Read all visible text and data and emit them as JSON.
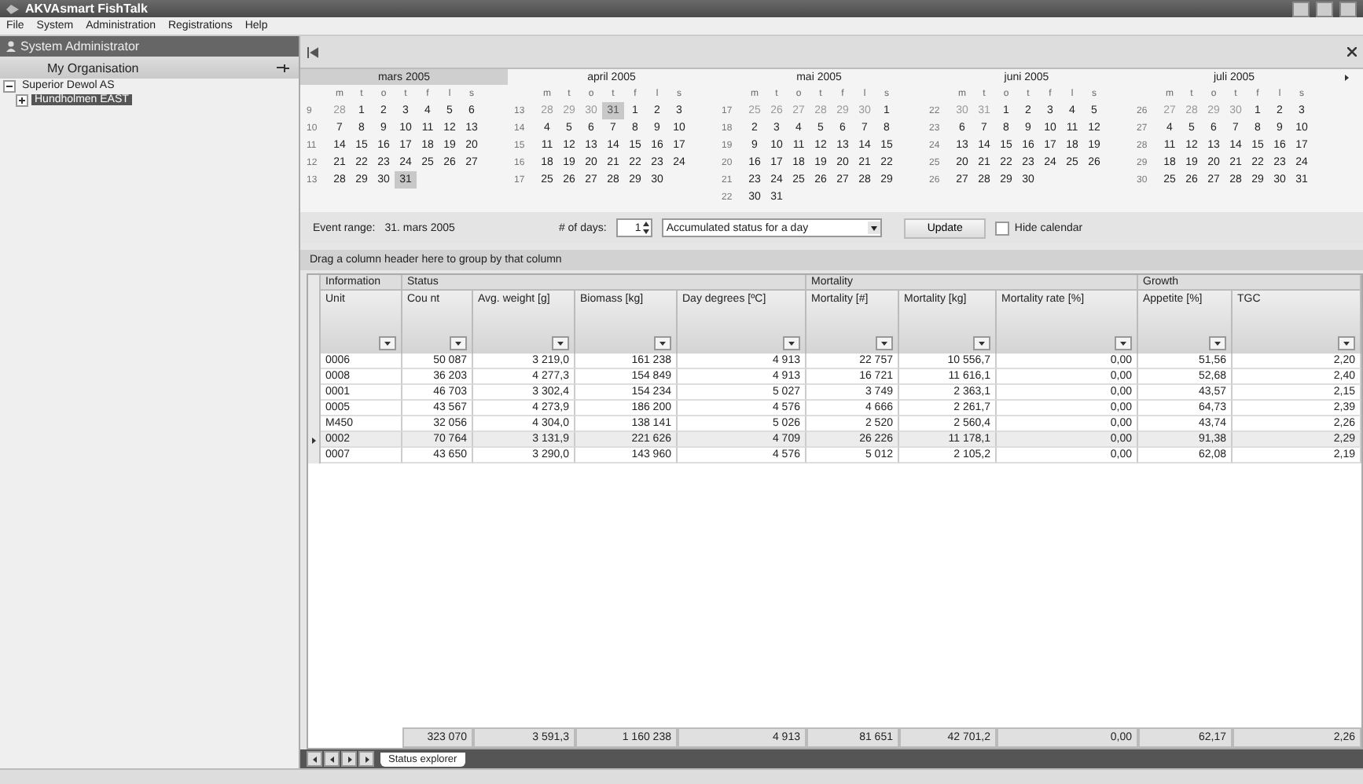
{
  "window": {
    "title": "AKVAsmart FishTalk"
  },
  "menu": [
    "File",
    "System",
    "Administration",
    "Registrations",
    "Help"
  ],
  "sidebar": {
    "header": "System Administrator",
    "section": "My Organisation",
    "tree": [
      {
        "label": "Superior Dewol AS",
        "expanded": true,
        "selected": false,
        "children": [
          {
            "label": "Hundholmen EAST",
            "expanded": false,
            "selected": true
          }
        ]
      }
    ]
  },
  "calendar": {
    "months": [
      {
        "title": "mars 2005",
        "selected": true,
        "weekdays": [
          "m",
          "t",
          "o",
          "t",
          "f",
          "l",
          "s"
        ],
        "weeks": [
          {
            "number": "9",
            "days": [
              {
                "day": "28",
                "outside": true,
                "selected": false
              },
              {
                "day": "1",
                "outside": false,
                "selected": false
              },
              {
                "day": "2",
                "outside": false,
                "selected": false
              },
              {
                "day": "3",
                "outside": false,
                "selected": false
              },
              {
                "day": "4",
                "outside": false,
                "selected": false
              },
              {
                "day": "5",
                "outside": false,
                "selected": false
              },
              {
                "day": "6",
                "outside": false,
                "selected": false
              }
            ]
          },
          {
            "number": "10",
            "days": [
              {
                "day": "7",
                "outside": false,
                "selected": false
              },
              {
                "day": "8",
                "outside": false,
                "selected": false
              },
              {
                "day": "9",
                "outside": false,
                "selected": false
              },
              {
                "day": "10",
                "outside": false,
                "selected": false
              },
              {
                "day": "11",
                "outside": false,
                "selected": false
              },
              {
                "day": "12",
                "outside": false,
                "selected": false
              },
              {
                "day": "13",
                "outside": false,
                "selected": false
              }
            ]
          },
          {
            "number": "11",
            "days": [
              {
                "day": "14",
                "outside": false,
                "selected": false
              },
              {
                "day": "15",
                "outside": false,
                "selected": false
              },
              {
                "day": "16",
                "outside": false,
                "selected": false
              },
              {
                "day": "17",
                "outside": false,
                "selected": false
              },
              {
                "day": "18",
                "outside": false,
                "selected": false
              },
              {
                "day": "19",
                "outside": false,
                "selected": false
              },
              {
                "day": "20",
                "outside": false,
                "selected": false
              }
            ]
          },
          {
            "number": "12",
            "days": [
              {
                "day": "21",
                "outside": false,
                "selected": false
              },
              {
                "day": "22",
                "outside": false,
                "selected": false
              },
              {
                "day": "23",
                "outside": false,
                "selected": false
              },
              {
                "day": "24",
                "outside": false,
                "selected": false
              },
              {
                "day": "25",
                "outside": false,
                "selected": false
              },
              {
                "day": "26",
                "outside": false,
                "selected": false
              },
              {
                "day": "27",
                "outside": false,
                "selected": false
              }
            ]
          },
          {
            "number": "13",
            "days": [
              {
                "day": "28",
                "outside": false,
                "selected": false
              },
              {
                "day": "29",
                "outside": false,
                "selected": false
              },
              {
                "day": "30",
                "outside": false,
                "selected": false
              },
              {
                "day": "31",
                "outside": false,
                "selected": true
              }
            ]
          }
        ]
      },
      {
        "title": "april 2005",
        "selected": false,
        "weekdays": [
          "m",
          "t",
          "o",
          "t",
          "f",
          "l",
          "s"
        ],
        "weeks": [
          {
            "number": "13",
            "days": [
              {
                "day": "28",
                "outside": true,
                "selected": false
              },
              {
                "day": "29",
                "outside": true,
                "selected": false
              },
              {
                "day": "30",
                "outside": true,
                "selected": false
              },
              {
                "day": "31",
                "outside": true,
                "selected": true
              },
              {
                "day": "1",
                "outside": false,
                "selected": false
              },
              {
                "day": "2",
                "outside": false,
                "selected": false
              },
              {
                "day": "3",
                "outside": false,
                "selected": false
              }
            ]
          },
          {
            "number": "14",
            "days": [
              {
                "day": "4",
                "outside": false,
                "selected": false
              },
              {
                "day": "5",
                "outside": false,
                "selected": false
              },
              {
                "day": "6",
                "outside": false,
                "selected": false
              },
              {
                "day": "7",
                "outside": false,
                "selected": false
              },
              {
                "day": "8",
                "outside": false,
                "selected": false
              },
              {
                "day": "9",
                "outside": false,
                "selected": false
              },
              {
                "day": "10",
                "outside": false,
                "selected": false
              }
            ]
          },
          {
            "number": "15",
            "days": [
              {
                "day": "11",
                "outside": false,
                "selected": false
              },
              {
                "day": "12",
                "outside": false,
                "selected": false
              },
              {
                "day": "13",
                "outside": false,
                "selected": false
              },
              {
                "day": "14",
                "outside": false,
                "selected": false
              },
              {
                "day": "15",
                "outside": false,
                "selected": false
              },
              {
                "day": "16",
                "outside": false,
                "selected": false
              },
              {
                "day": "17",
                "outside": false,
                "selected": false
              }
            ]
          },
          {
            "number": "16",
            "days": [
              {
                "day": "18",
                "outside": false,
                "selected": false
              },
              {
                "day": "19",
                "outside": false,
                "selected": false
              },
              {
                "day": "20",
                "outside": false,
                "selected": false
              },
              {
                "day": "21",
                "outside": false,
                "selected": false
              },
              {
                "day": "22",
                "outside": false,
                "selected": false
              },
              {
                "day": "23",
                "outside": false,
                "selected": false
              },
              {
                "day": "24",
                "outside": false,
                "selected": false
              }
            ]
          },
          {
            "number": "17",
            "days": [
              {
                "day": "25",
                "outside": false,
                "selected": false
              },
              {
                "day": "26",
                "outside": false,
                "selected": false
              },
              {
                "day": "27",
                "outside": false,
                "selected": false
              },
              {
                "day": "28",
                "outside": false,
                "selected": false
              },
              {
                "day": "29",
                "outside": false,
                "selected": false
              },
              {
                "day": "30",
                "outside": false,
                "selected": false
              }
            ]
          }
        ]
      },
      {
        "title": "mai 2005",
        "selected": false,
        "weekdays": [
          "m",
          "t",
          "o",
          "t",
          "f",
          "l",
          "s"
        ],
        "weeks": [
          {
            "number": "17",
            "days": [
              {
                "day": "25",
                "outside": true,
                "selected": false
              },
              {
                "day": "26",
                "outside": true,
                "selected": false
              },
              {
                "day": "27",
                "outside": true,
                "selected": false
              },
              {
                "day": "28",
                "outside": true,
                "selected": false
              },
              {
                "day": "29",
                "outside": true,
                "selected": false
              },
              {
                "day": "30",
                "outside": true,
                "selected": false
              },
              {
                "day": "1",
                "outside": false,
                "selected": false
              }
            ]
          },
          {
            "number": "18",
            "days": [
              {
                "day": "2",
                "outside": false,
                "selected": false
              },
              {
                "day": "3",
                "outside": false,
                "selected": false
              },
              {
                "day": "4",
                "outside": false,
                "selected": false
              },
              {
                "day": "5",
                "outside": false,
                "selected": false
              },
              {
                "day": "6",
                "outside": false,
                "selected": false
              },
              {
                "day": "7",
                "outside": false,
                "selected": false
              },
              {
                "day": "8",
                "outside": false,
                "selected": false
              }
            ]
          },
          {
            "number": "19",
            "days": [
              {
                "day": "9",
                "outside": false,
                "selected": false
              },
              {
                "day": "10",
                "outside": false,
                "selected": false
              },
              {
                "day": "11",
                "outside": false,
                "selected": false
              },
              {
                "day": "12",
                "outside": false,
                "selected": false
              },
              {
                "day": "13",
                "outside": false,
                "selected": false
              },
              {
                "day": "14",
                "outside": false,
                "selected": false
              },
              {
                "day": "15",
                "outside": false,
                "selected": false
              }
            ]
          },
          {
            "number": "20",
            "days": [
              {
                "day": "16",
                "outside": false,
                "selected": false
              },
              {
                "day": "17",
                "outside": false,
                "selected": false
              },
              {
                "day": "18",
                "outside": false,
                "selected": false
              },
              {
                "day": "19",
                "outside": false,
                "selected": false
              },
              {
                "day": "20",
                "outside": false,
                "selected": false
              },
              {
                "day": "21",
                "outside": false,
                "selected": false
              },
              {
                "day": "22",
                "outside": false,
                "selected": false
              }
            ]
          },
          {
            "number": "21",
            "days": [
              {
                "day": "23",
                "outside": false,
                "selected": false
              },
              {
                "day": "24",
                "outside": false,
                "selected": false
              },
              {
                "day": "25",
                "outside": false,
                "selected": false
              },
              {
                "day": "26",
                "outside": false,
                "selected": false
              },
              {
                "day": "27",
                "outside": false,
                "selected": false
              },
              {
                "day": "28",
                "outside": false,
                "selected": false
              },
              {
                "day": "29",
                "outside": false,
                "selected": false
              }
            ]
          },
          {
            "number": "22",
            "days": [
              {
                "day": "30",
                "outside": false,
                "selected": false
              },
              {
                "day": "31",
                "outside": false,
                "selected": false
              }
            ]
          }
        ]
      },
      {
        "title": "juni 2005",
        "selected": false,
        "weekdays": [
          "m",
          "t",
          "o",
          "t",
          "f",
          "l",
          "s"
        ],
        "weeks": [
          {
            "number": "22",
            "days": [
              {
                "day": "30",
                "outside": true,
                "selected": false
              },
              {
                "day": "31",
                "outside": true,
                "selected": false
              },
              {
                "day": "1",
                "outside": false,
                "selected": false
              },
              {
                "day": "2",
                "outside": false,
                "selected": false
              },
              {
                "day": "3",
                "outside": false,
                "selected": false
              },
              {
                "day": "4",
                "outside": false,
                "selected": false
              },
              {
                "day": "5",
                "outside": false,
                "selected": false
              }
            ]
          },
          {
            "number": "23",
            "days": [
              {
                "day": "6",
                "outside": false,
                "selected": false
              },
              {
                "day": "7",
                "outside": false,
                "selected": false
              },
              {
                "day": "8",
                "outside": false,
                "selected": false
              },
              {
                "day": "9",
                "outside": false,
                "selected": false
              },
              {
                "day": "10",
                "outside": false,
                "selected": false
              },
              {
                "day": "11",
                "outside": false,
                "selected": false
              },
              {
                "day": "12",
                "outside": false,
                "selected": false
              }
            ]
          },
          {
            "number": "24",
            "days": [
              {
                "day": "13",
                "outside": false,
                "selected": false
              },
              {
                "day": "14",
                "outside": false,
                "selected": false
              },
              {
                "day": "15",
                "outside": false,
                "selected": false
              },
              {
                "day": "16",
                "outside": false,
                "selected": false
              },
              {
                "day": "17",
                "outside": false,
                "selected": false
              },
              {
                "day": "18",
                "outside": false,
                "selected": false
              },
              {
                "day": "19",
                "outside": false,
                "selected": false
              }
            ]
          },
          {
            "number": "25",
            "days": [
              {
                "day": "20",
                "outside": false,
                "selected": false
              },
              {
                "day": "21",
                "outside": false,
                "selected": false
              },
              {
                "day": "22",
                "outside": false,
                "selected": false
              },
              {
                "day": "23",
                "outside": false,
                "selected": false
              },
              {
                "day": "24",
                "outside": false,
                "selected": false
              },
              {
                "day": "25",
                "outside": false,
                "selected": false
              },
              {
                "day": "26",
                "outside": false,
                "selected": false
              }
            ]
          },
          {
            "number": "26",
            "days": [
              {
                "day": "27",
                "outside": false,
                "selected": false
              },
              {
                "day": "28",
                "outside": false,
                "selected": false
              },
              {
                "day": "29",
                "outside": false,
                "selected": false
              },
              {
                "day": "30",
                "outside": false,
                "selected": false
              }
            ]
          }
        ]
      },
      {
        "title": "juli 2005",
        "selected": false,
        "weekdays": [
          "m",
          "t",
          "o",
          "t",
          "f",
          "l",
          "s"
        ],
        "weeks": [
          {
            "number": "26",
            "days": [
              {
                "day": "27",
                "outside": true,
                "selected": false
              },
              {
                "day": "28",
                "outside": true,
                "selected": false
              },
              {
                "day": "29",
                "outside": true,
                "selected": false
              },
              {
                "day": "30",
                "outside": true,
                "selected": false
              },
              {
                "day": "1",
                "outside": false,
                "selected": false
              },
              {
                "day": "2",
                "outside": false,
                "selected": false
              },
              {
                "day": "3",
                "outside": false,
                "selected": false
              }
            ]
          },
          {
            "number": "27",
            "days": [
              {
                "day": "4",
                "outside": false,
                "selected": false
              },
              {
                "day": "5",
                "outside": false,
                "selected": false
              },
              {
                "day": "6",
                "outside": false,
                "selected": false
              },
              {
                "day": "7",
                "outside": false,
                "selected": false
              },
              {
                "day": "8",
                "outside": false,
                "selected": false
              },
              {
                "day": "9",
                "outside": false,
                "selected": false
              },
              {
                "day": "10",
                "outside": false,
                "selected": false
              }
            ]
          },
          {
            "number": "28",
            "days": [
              {
                "day": "11",
                "outside": false,
                "selected": false
              },
              {
                "day": "12",
                "outside": false,
                "selected": false
              },
              {
                "day": "13",
                "outside": false,
                "selected": false
              },
              {
                "day": "14",
                "outside": false,
                "selected": false
              },
              {
                "day": "15",
                "outside": false,
                "selected": false
              },
              {
                "day": "16",
                "outside": false,
                "selected": false
              },
              {
                "day": "17",
                "outside": false,
                "selected": false
              }
            ]
          },
          {
            "number": "29",
            "days": [
              {
                "day": "18",
                "outside": false,
                "selected": false
              },
              {
                "day": "19",
                "outside": false,
                "selected": false
              },
              {
                "day": "20",
                "outside": false,
                "selected": false
              },
              {
                "day": "21",
                "outside": false,
                "selected": false
              },
              {
                "day": "22",
                "outside": false,
                "selected": false
              },
              {
                "day": "23",
                "outside": false,
                "selected": false
              },
              {
                "day": "24",
                "outside": false,
                "selected": false
              }
            ]
          },
          {
            "number": "30",
            "days": [
              {
                "day": "25",
                "outside": false,
                "selected": false
              },
              {
                "day": "26",
                "outside": false,
                "selected": false
              },
              {
                "day": "27",
                "outside": false,
                "selected": false
              },
              {
                "day": "28",
                "outside": false,
                "selected": false
              },
              {
                "day": "29",
                "outside": false,
                "selected": false
              },
              {
                "day": "30",
                "outside": false,
                "selected": false
              },
              {
                "day": "31",
                "outside": false,
                "selected": false
              }
            ]
          }
        ]
      }
    ]
  },
  "controls": {
    "event_range_label": "Event range:",
    "event_range": "31. mars 2005",
    "days_label": "# of days:",
    "days_value": "1",
    "status_type": "Accumulated status for a day",
    "update_button": "Update",
    "hide_calendar": {
      "label": "Hide calendar",
      "checked": false
    }
  },
  "grid": {
    "group_hint": "Drag a column header here to group by that column",
    "groups": [
      {
        "label": "Information",
        "columns": [
          "Unit"
        ]
      },
      {
        "label": "Status",
        "columns": [
          "Cou nt",
          "Avg. weight [g]",
          "Biomass [kg]",
          "Day degrees [ºC]"
        ]
      },
      {
        "label": "Mortality",
        "columns": [
          "Mortality [#]",
          "Mortality [kg]",
          "Mortality rate [%]"
        ]
      },
      {
        "label": "Growth",
        "columns": [
          "Appetite [%]",
          "TGC"
        ]
      }
    ],
    "rows": [
      {
        "current": false,
        "cells": [
          "0006",
          "50 087",
          "3 219,0",
          "161 238",
          "4 913",
          "22 757",
          "10 556,7",
          "0,00",
          "51,56",
          "2,20"
        ]
      },
      {
        "current": false,
        "cells": [
          "0008",
          "36 203",
          "4 277,3",
          "154 849",
          "4 913",
          "16 721",
          "11 616,1",
          "0,00",
          "52,68",
          "2,40"
        ]
      },
      {
        "current": false,
        "cells": [
          "0001",
          "46 703",
          "3 302,4",
          "154 234",
          "5 027",
          "3 749",
          "2 363,1",
          "0,00",
          "43,57",
          "2,15"
        ]
      },
      {
        "current": false,
        "cells": [
          "0005",
          "43 567",
          "4 273,9",
          "186 200",
          "4 576",
          "4 666",
          "2 261,7",
          "0,00",
          "64,73",
          "2,39"
        ]
      },
      {
        "current": false,
        "cells": [
          "M450",
          "32 056",
          "4 304,0",
          "138 141",
          "5 026",
          "2 520",
          "2 560,4",
          "0,00",
          "43,74",
          "2,26"
        ]
      },
      {
        "current": true,
        "cells": [
          "0002",
          "70 764",
          "3 131,9",
          "221 626",
          "4 709",
          "26 226",
          "11 178,1",
          "0,00",
          "91,38",
          "2,29"
        ]
      },
      {
        "current": false,
        "cells": [
          "0007",
          "43 650",
          "3 290,0",
          "143 960",
          "4 576",
          "5 012",
          "2 105,2",
          "0,00",
          "62,08",
          "2,19"
        ]
      }
    ],
    "totals": [
      "323 070",
      "3 591,3",
      "1 160 238",
      "4 913",
      "81 651",
      "42 701,2",
      "0,00",
      "62,17",
      "2,26"
    ]
  },
  "tabs": [
    {
      "label": "Status explorer",
      "selected": true
    }
  ]
}
